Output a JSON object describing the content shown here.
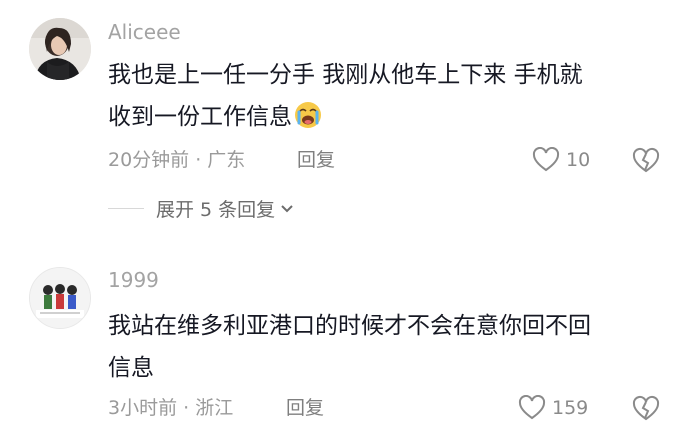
{
  "comments": [
    {
      "username": "Aliceee",
      "text_line1": "我也是上一任一分手 我刚从他车上下来 手机就",
      "text_line2": "收到一份工作信息",
      "time_location": "20分钟前 · 广东",
      "reply_label": "回复",
      "likes": "10",
      "expand_label": "展开 5 条回复",
      "icons": {
        "emoji": "crying-face-emoji",
        "like": "heart-outline-icon",
        "dislike": "broken-heart-icon",
        "expand": "chevron-down-icon"
      }
    },
    {
      "username": "1999",
      "text_line1": "我站在维多利亚港口的时候才不会在意你回不回",
      "text_line2": "信息",
      "time_location": "3小时前 · 浙江",
      "reply_label": "回复",
      "likes": "159",
      "icons": {
        "like": "heart-outline-icon",
        "dislike": "broken-heart-icon"
      }
    }
  ],
  "colors": {
    "text": "#161823",
    "username": "#a3a3a3",
    "meta": "#9a9a9a",
    "expand": "#6c6c6c",
    "emoji": "#f7c948"
  }
}
